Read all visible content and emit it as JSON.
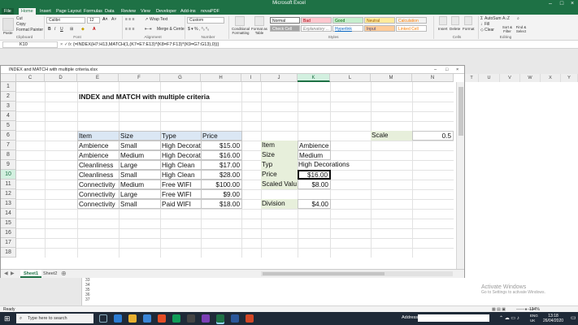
{
  "app": {
    "title": "Microsoft Excel"
  },
  "ribbon": {
    "tabs": [
      "File",
      "Home",
      "Insert",
      "Page Layout",
      "Formulas",
      "Data",
      "Review",
      "View",
      "Developer",
      "Add-ins",
      "novaPDF"
    ],
    "clipboard": {
      "cut": "Cut",
      "copy": "Copy",
      "format_painter": "Format Painter",
      "paste": "Paste",
      "group": "Clipboard"
    },
    "font": {
      "name": "Calibri",
      "size": "12",
      "group": "Font"
    },
    "alignment": {
      "wrap": "Wrap Text",
      "merge": "Merge & Center",
      "group": "Alignment"
    },
    "number": {
      "format": "Custom",
      "group": "Number"
    },
    "styles": {
      "group": "Styles",
      "conditional": "Conditional Formatting",
      "table": "Format as Table",
      "items": [
        "Normal",
        "Bad",
        "Good",
        "Neutral",
        "Calculation",
        "Check Cell",
        "Explanatory ...",
        "Hyperlink",
        "Input",
        "Linked Cell"
      ]
    },
    "cells": {
      "insert": "Insert",
      "delete": "Delete",
      "format": "Format",
      "group": "Cells"
    },
    "editing": {
      "autosum": "AutoSum",
      "fill": "Fill",
      "clear": "Clear",
      "sort": "Sort & Filter",
      "find": "Find & Select",
      "group": "Editing"
    }
  },
  "formula_bar": {
    "name_box": "K10",
    "fx": "fx",
    "formula": "{=INDEX(H7:H13,MATCH(1,(K7=E7:E13)*(K8=F7:F13)*(K9=G7:G13),0))}"
  },
  "workbook_window": {
    "title": "INDEX and MATCH with multiple criteria.xlsx"
  },
  "sheet": {
    "columns": [
      "C",
      "D",
      "E",
      "F",
      "G",
      "H",
      "I",
      "J",
      "K",
      "L",
      "M",
      "N"
    ],
    "rows": [
      "1",
      "2",
      "3",
      "4",
      "5",
      "6",
      "7",
      "8",
      "9",
      "10",
      "11",
      "12",
      "13",
      "14",
      "15",
      "16",
      "17",
      "18"
    ],
    "selected_column": "K",
    "selected_row": "10",
    "title": "INDEX and MATCH with multiple criteria",
    "table_headers": [
      "Item",
      "Size",
      "Type",
      "Price"
    ],
    "table_rows": [
      [
        "Ambience",
        "Small",
        "High Decorat",
        "$15.00"
      ],
      [
        "Ambience",
        "Medium",
        "High Decorat",
        "$16.00"
      ],
      [
        "Cleanliness",
        "Large",
        "High Clean",
        "$17.00"
      ],
      [
        "Cleanliness",
        "Small",
        "High Clean",
        "$28.00"
      ],
      [
        "Connectivity",
        "Medium",
        "Free WIFI",
        "$100.00"
      ],
      [
        "Connectivity",
        "Large",
        "Free WIFI",
        "$9.00"
      ],
      [
        "Connectivity",
        "Small",
        "Paid WIFI",
        "$18.00"
      ]
    ],
    "lookup": [
      {
        "label": "Item",
        "value": "Ambience"
      },
      {
        "label": "Size",
        "value": "Medium"
      },
      {
        "label": "Typ",
        "value": "High Decorations"
      },
      {
        "label": "Price",
        "value": "$16.00"
      },
      {
        "label": "Scaled Valu",
        "value": "$8.00"
      }
    ],
    "division": {
      "label": "Division",
      "value": "$4.00"
    },
    "scale": {
      "label": "Scale",
      "value": "0.5"
    },
    "tabs": [
      "Sheet1",
      "Sheet2"
    ]
  },
  "bg_sheet": {
    "columns": [
      "T",
      "U",
      "V",
      "W",
      "X",
      "Y"
    ],
    "rows": [
      "33",
      "34",
      "35",
      "36",
      "37",
      "38"
    ]
  },
  "status": {
    "ready": "Ready",
    "zoom": "134%"
  },
  "taskbar": {
    "search_placeholder": "Type here to search",
    "address_label": "Address",
    "clock_time": "13:18",
    "clock_date": "26/04/2020",
    "lang": "ENG UK"
  },
  "watermark": {
    "line1": "Activate Windows",
    "line2": "Go to Settings to activate Windows."
  },
  "colors": {
    "excel_green": "#1e7145",
    "header_fill": "#dbe7f4",
    "label_fill": "#e7efdb"
  }
}
